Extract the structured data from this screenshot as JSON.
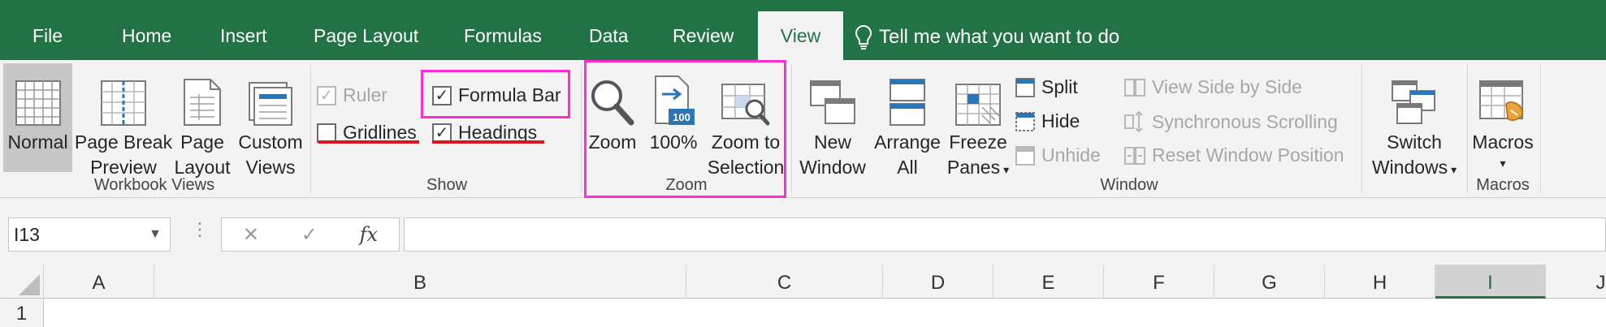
{
  "tabs": {
    "file": "File",
    "home": "Home",
    "insert": "Insert",
    "page_layout": "Page Layout",
    "formulas": "Formulas",
    "data": "Data",
    "review": "Review",
    "view": "View",
    "tell_me": "Tell me what you want to do"
  },
  "workbook_views": {
    "normal": "Normal",
    "page_break_1": "Page Break",
    "page_break_2": "Preview",
    "page_layout_1": "Page",
    "page_layout_2": "Layout",
    "custom_1": "Custom",
    "custom_2": "Views",
    "group_label": "Workbook Views"
  },
  "show": {
    "ruler": "Ruler",
    "formula_bar": "Formula Bar",
    "gridlines": "Gridlines",
    "headings": "Headings",
    "group_label": "Show"
  },
  "zoom": {
    "zoom": "Zoom",
    "hundred": "100%",
    "hundred_badge": "100",
    "zoom_sel_1": "Zoom to",
    "zoom_sel_2": "Selection",
    "group_label": "Zoom"
  },
  "window": {
    "new_1": "New",
    "new_2": "Window",
    "arrange_1": "Arrange",
    "arrange_2": "All",
    "freeze_1": "Freeze",
    "freeze_2": "Panes",
    "split": "Split",
    "hide": "Hide",
    "unhide": "Unhide",
    "side_by_side": "View Side by Side",
    "sync_scroll": "Synchronous Scrolling",
    "reset_pos": "Reset Window Position",
    "switch_1": "Switch",
    "switch_2": "Windows",
    "group_label": "Window"
  },
  "macros": {
    "label": "Macros",
    "group_label": "Macros"
  },
  "formula_bar": {
    "name_box": "I13",
    "cancel": "✕",
    "enter": "✓",
    "fx": "fx",
    "dots": "⋮"
  },
  "columns": [
    "A",
    "B",
    "C",
    "D",
    "E",
    "F",
    "G",
    "H",
    "I",
    "J"
  ],
  "rows": [
    "1"
  ],
  "colors": {
    "brand_green": "#217346",
    "highlight_magenta": "#ff2bd4",
    "strike_red": "#e0141e"
  }
}
